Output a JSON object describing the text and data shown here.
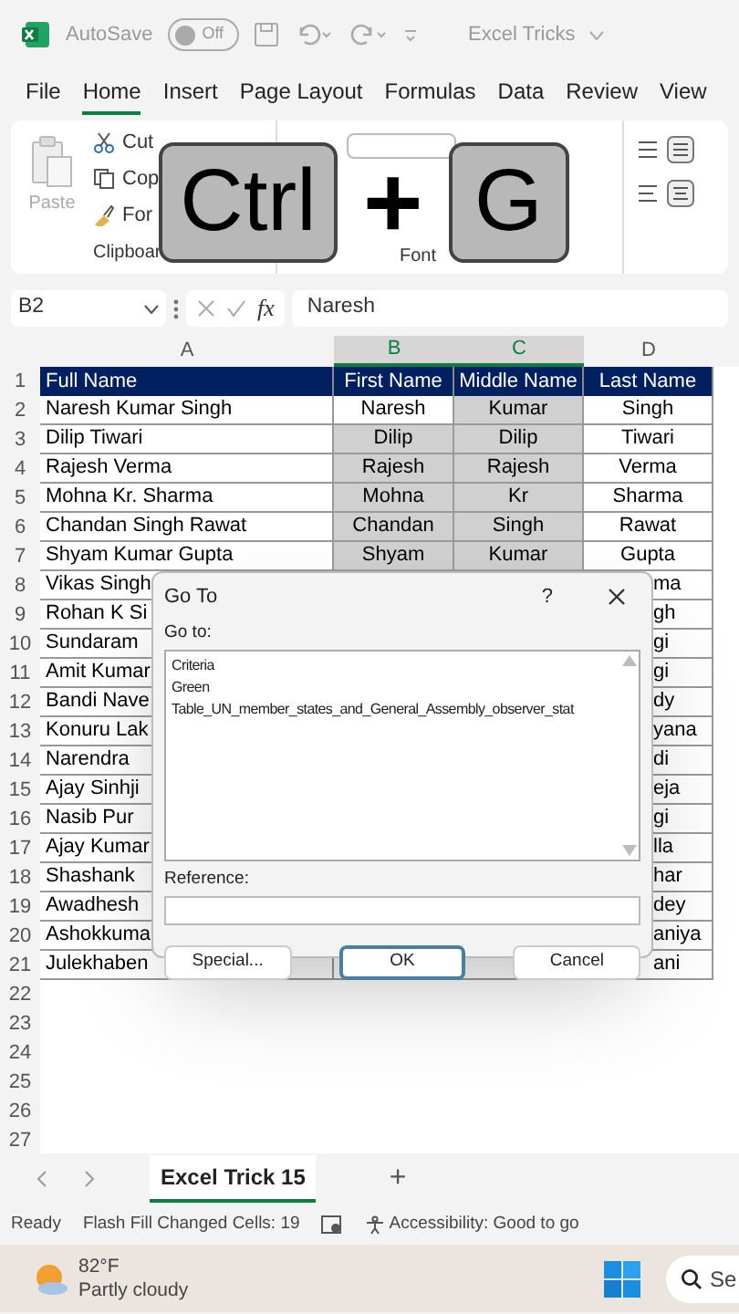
{
  "title_bar": {
    "autosave_label": "AutoSave",
    "autosave_on": false,
    "toggle_text": "Off",
    "file_name": "Excel Tricks"
  },
  "ribbon_tabs": [
    {
      "label": "File",
      "selected": false
    },
    {
      "label": "Home",
      "selected": true
    },
    {
      "label": "Insert",
      "selected": false
    },
    {
      "label": "Page Layout",
      "selected": false
    },
    {
      "label": "Formulas",
      "selected": false
    },
    {
      "label": "Data",
      "selected": false
    },
    {
      "label": "Review",
      "selected": false
    },
    {
      "label": "View",
      "selected": false
    }
  ],
  "ribbon": {
    "paste_label": "Paste",
    "clipboard_items": [
      "Cut",
      "Cop",
      "For"
    ],
    "group_labels": [
      "Clipboar",
      "Font"
    ]
  },
  "key_overlay": [
    "Ctrl",
    "+",
    "G"
  ],
  "formula_bar": {
    "name_box": "B2",
    "fx": "fx",
    "value": "Naresh"
  },
  "sheet": {
    "columns": [
      {
        "label": "A",
        "selected": false
      },
      {
        "label": "B",
        "selected": true
      },
      {
        "label": "C",
        "selected": true
      },
      {
        "label": "D",
        "selected": false
      }
    ],
    "rows": [
      {
        "number": "1",
        "kind": "header",
        "cells": [
          "Full Name",
          "First Name",
          "Middle Name",
          "Last Name"
        ]
      },
      {
        "number": "2",
        "kind": "full",
        "cells": [
          "Naresh Kumar Singh",
          "Naresh",
          "Kumar",
          "Singh"
        ],
        "highlighted": [
          false,
          false,
          true,
          false
        ]
      },
      {
        "number": "3",
        "kind": "full",
        "cells": [
          "Dilip Tiwari",
          "Dilip",
          "Dilip",
          "Tiwari"
        ],
        "highlighted": [
          false,
          true,
          true,
          false
        ]
      },
      {
        "number": "4",
        "kind": "full",
        "cells": [
          "Rajesh Verma",
          "Rajesh",
          "Rajesh",
          "Verma"
        ],
        "highlighted": [
          false,
          true,
          true,
          false
        ]
      },
      {
        "number": "5",
        "kind": "full",
        "cells": [
          "Mohna Kr. Sharma",
          "Mohna",
          "Kr",
          "Sharma"
        ],
        "highlighted": [
          false,
          true,
          true,
          false
        ]
      },
      {
        "number": "6",
        "kind": "full",
        "cells": [
          "Chandan Singh Rawat",
          "Chandan",
          "Singh",
          "Rawat"
        ],
        "highlighted": [
          false,
          true,
          true,
          false
        ]
      },
      {
        "number": "7",
        "kind": "full",
        "cells": [
          "Shyam Kumar Gupta",
          "Shyam",
          "Kumar",
          "Gupta"
        ],
        "highlighted": [
          false,
          true,
          true,
          false
        ]
      },
      {
        "number": "8",
        "kind": "partial",
        "cells": [
          "Vikas Singh",
          "ma"
        ]
      },
      {
        "number": "9",
        "kind": "partial",
        "cells": [
          "Rohan K Si",
          "gh"
        ]
      },
      {
        "number": "10",
        "kind": "partial",
        "cells": [
          "Sundaram",
          "gi"
        ]
      },
      {
        "number": "11",
        "kind": "partial",
        "cells": [
          "Amit Kumar",
          "gi"
        ]
      },
      {
        "number": "12",
        "kind": "partial",
        "cells": [
          "Bandi Nave",
          "dy"
        ]
      },
      {
        "number": "13",
        "kind": "partial",
        "cells": [
          "Konuru Lak",
          "yana"
        ]
      },
      {
        "number": "14",
        "kind": "partial",
        "cells": [
          "Narendra",
          "di"
        ]
      },
      {
        "number": "15",
        "kind": "partial",
        "cells": [
          "Ajay Sinhji",
          "eja"
        ]
      },
      {
        "number": "16",
        "kind": "partial",
        "cells": [
          "Nasib Pur",
          "gi"
        ]
      },
      {
        "number": "17",
        "kind": "partial",
        "cells": [
          "Ajay Kumar",
          "lla"
        ]
      },
      {
        "number": "18",
        "kind": "partial",
        "cells": [
          "Shashank",
          "har"
        ]
      },
      {
        "number": "19",
        "kind": "partial",
        "cells": [
          "Awadhesh",
          "dey"
        ]
      },
      {
        "number": "20",
        "kind": "partial",
        "cells": [
          "Ashokkuma",
          "aniya"
        ]
      },
      {
        "number": "21",
        "kind": "partial",
        "cells": [
          "Julekhaben",
          "ani"
        ]
      }
    ],
    "empty_rows": [
      "22",
      "23",
      "24",
      "25",
      "26",
      "27"
    ]
  },
  "dialog": {
    "title": "Go To",
    "help": "?",
    "list_label": "Go to:",
    "items": [
      "Criteria",
      "Green",
      "Table_UN_member_states_and_General_Assembly_observer_stat"
    ],
    "reference_label": "Reference:",
    "buttons": [
      {
        "label": "Special...",
        "default": false
      },
      {
        "label": "OK",
        "default": true
      },
      {
        "label": "Cancel",
        "default": false
      }
    ]
  },
  "sheet_tabs": [
    {
      "label": "Excel Trick 15",
      "selected": true
    }
  ],
  "add_sheet": "+",
  "status_bar": {
    "mode": "Ready",
    "message": "Flash Fill Changed Cells: 19",
    "accessibility": "Accessibility: Good to go"
  },
  "taskbar": {
    "temperature": "82°F",
    "condition": "Partly cloudy",
    "search": "Se"
  }
}
